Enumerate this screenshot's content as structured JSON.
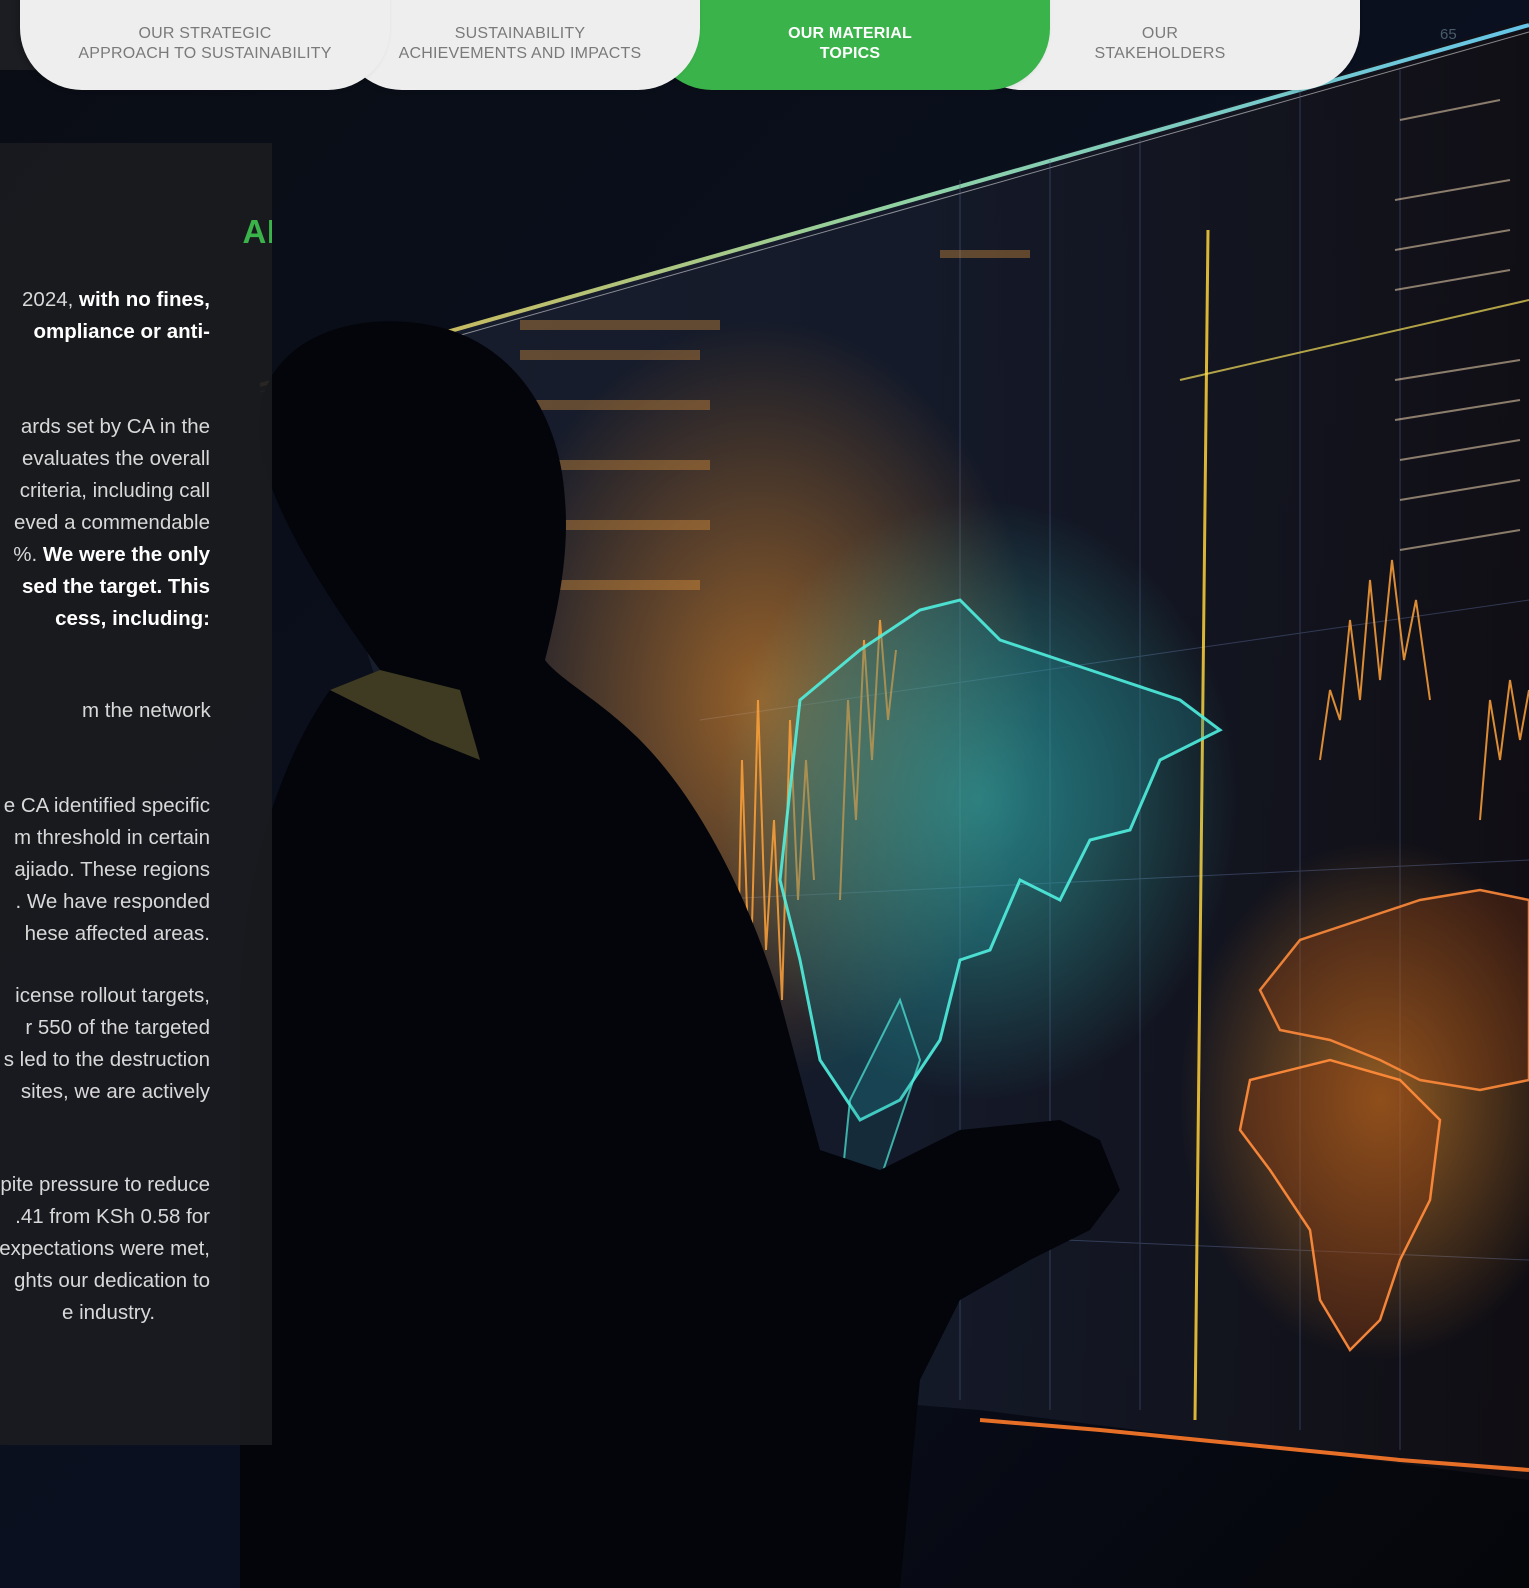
{
  "nav": {
    "tabs": [
      {
        "label": "Our strategic\napproach to sustainability",
        "active": false
      },
      {
        "label": "Sustainability\nachievements and impacts",
        "active": false
      },
      {
        "label": "Our material\ntopics",
        "active": true
      },
      {
        "label": "Our\nstakeholders",
        "active": false
      }
    ],
    "page_number": "65"
  },
  "content": {
    "heading": "ANCE",
    "intro_lines": [
      "2024, with no fines,",
      "ompliance or anti-"
    ],
    "p1_lines": [
      "ards set by CA in the",
      "evaluates the overall",
      "criteria, including call",
      "eved a commendable",
      "%. We were the only",
      "sed the target. This",
      "cess, including:"
    ],
    "p2_lines": [
      "m the network"
    ],
    "p3_lines": [
      "e CA identified specific",
      "m threshold in certain",
      "ajiado. These regions",
      ". We have responded",
      "hese affected areas."
    ],
    "p4_lines": [
      "icense rollout targets,",
      "r 550 of the targeted",
      "s led to the destruction",
      "sites, we are actively"
    ],
    "p5_lines": [
      "pite pressure to reduce",
      ".41 from KSh 0.58 for",
      "expectations were met,",
      "ghts our dedication to",
      "e industry."
    ]
  },
  "colors": {
    "accent_green": "#3ab34a",
    "tab_light": "#eeeeee",
    "panel_bg": "#1a1b1f"
  },
  "image": {
    "description_icon": "person-viewing-world-map-data-wall"
  }
}
